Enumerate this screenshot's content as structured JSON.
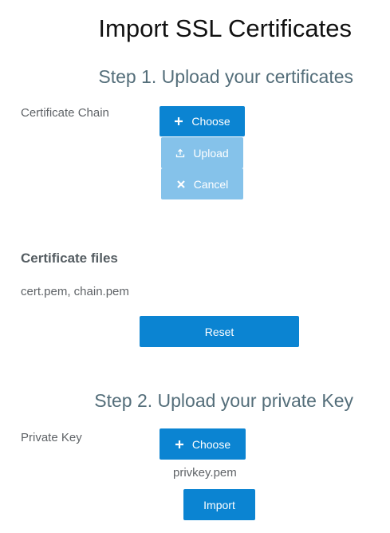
{
  "page": {
    "title": "Import SSL Certificates"
  },
  "step1": {
    "title": "Step 1. Upload your certificates",
    "chain_label": "Certificate Chain",
    "choose_label": "Choose",
    "upload_label": "Upload",
    "cancel_label": "Cancel",
    "files_heading": "Certificate files",
    "files_value": "cert.pem, chain.pem",
    "reset_label": "Reset"
  },
  "step2": {
    "title": "Step 2. Upload your private Key",
    "key_label": "Private Key",
    "choose_label": "Choose",
    "key_file_value": "privkey.pem",
    "import_label": "Import"
  },
  "icons": {
    "choose": "plus-icon",
    "upload": "upload-icon",
    "cancel": "close-icon"
  },
  "colors": {
    "primary_button": "#0b84d2",
    "disabled_button": "#85c2ea",
    "step_title": "#546e7a",
    "page_title": "#111111"
  }
}
